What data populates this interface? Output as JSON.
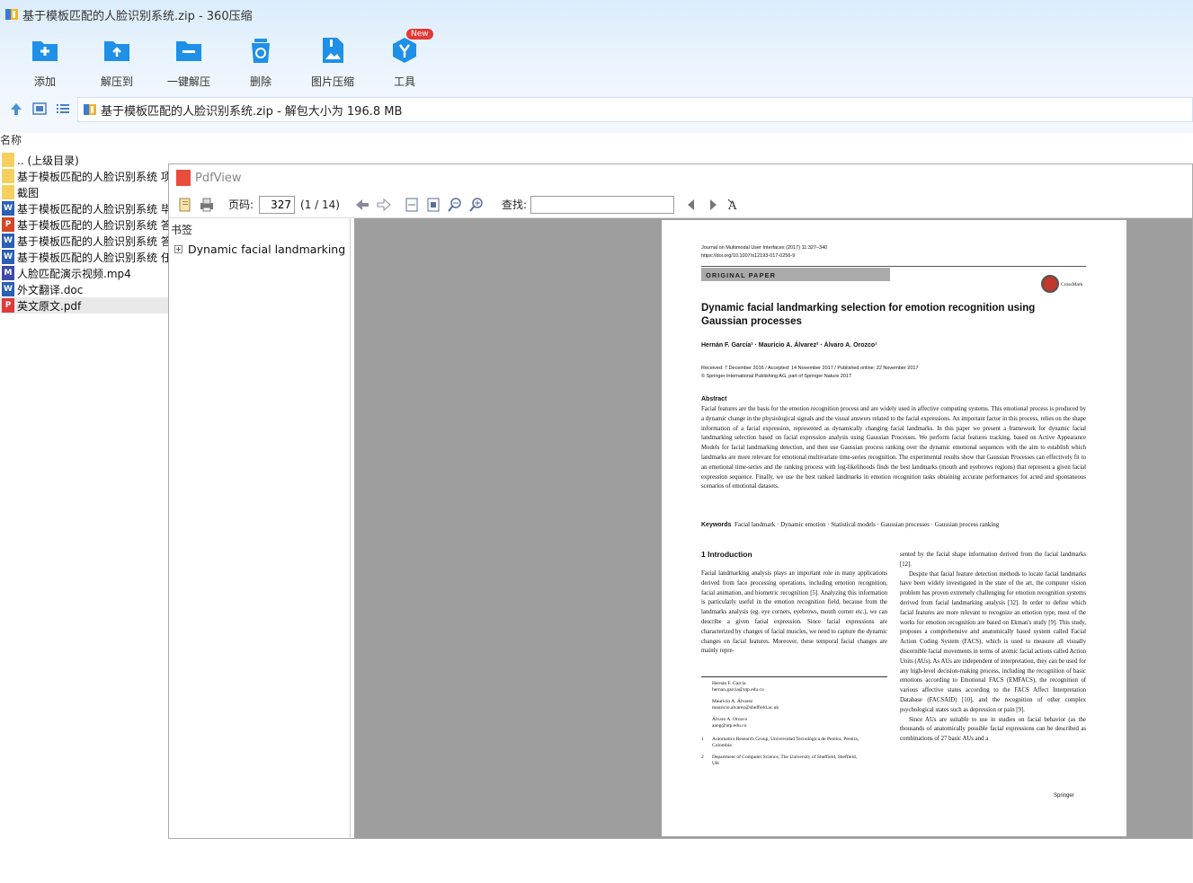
{
  "window": {
    "title": "基于模板匹配的人脸识别系统.zip - 360压缩"
  },
  "toolbar": {
    "buttons": [
      {
        "label": "添加",
        "icon": "add-icon"
      },
      {
        "label": "解压到",
        "icon": "extract-to-icon"
      },
      {
        "label": "一键解压",
        "icon": "one-click-extract-icon"
      },
      {
        "label": "删除",
        "icon": "delete-icon"
      },
      {
        "label": "图片压缩",
        "icon": "image-compress-icon"
      },
      {
        "label": "工具",
        "icon": "tools-icon"
      }
    ],
    "new_badge": "New"
  },
  "address": {
    "text": "基于模板匹配的人脸识别系统.zip - 解包大小为 196.8 MB"
  },
  "filelist": {
    "column_name": "名称",
    "items": [
      {
        "name": ".. (上级目录)",
        "type": "folder"
      },
      {
        "name": "基于模板匹配的人脸识别系统 项",
        "type": "folder"
      },
      {
        "name": "截图",
        "type": "folder"
      },
      {
        "name": "基于模板匹配的人脸识别系统 毕",
        "type": "word"
      },
      {
        "name": "基于模板匹配的人脸识别系统 答",
        "type": "ppt"
      },
      {
        "name": "基于模板匹配的人脸识别系统 答",
        "type": "word"
      },
      {
        "name": "基于模板匹配的人脸识别系统 任",
        "type": "word"
      },
      {
        "name": "人脸匹配演示视频.mp4",
        "type": "mp4"
      },
      {
        "name": "外文翻译.doc",
        "type": "word"
      },
      {
        "name": "英文原文.pdf",
        "type": "pdf"
      }
    ],
    "selected_index": 9
  },
  "pdfview": {
    "title": "PdfView",
    "page_label": "页码:",
    "page_value": "327",
    "page_count": "(1 / 14)",
    "search_label": "查找:",
    "bookmarks_label": "书签",
    "bookmark_item": "Dynamic facial landmarking se"
  },
  "paper": {
    "journal": "Journal on Multimodal User Interfaces (2017) 11:327–340",
    "doi": "https://doi.org/10.1007/s12193-017-0256-9",
    "section_tag": "ORIGINAL PAPER",
    "crossmark": "CrossMark",
    "title": "Dynamic facial landmarking selection for emotion recognition using Gaussian processes",
    "authors": "Hernán F. García¹ · Mauricio A. Álvarez² · Álvaro A. Orozco¹",
    "received": "Received: 7 December 2016 / Accepted: 14 November 2017 / Published online: 22 November 2017",
    "copyright": "© Springer International Publishing AG, part of Springer Nature 2017",
    "abstract_head": "Abstract",
    "abstract": "Facial features are the basis for the emotion recognition process and are widely used in affective computing systems. This emotional process is produced by a dynamic change in the physiological signals and the visual answers related to the facial expressions. An important factor in this process, relies on the shape information of a facial expression, represented as dynamically changing facial landmarks. In this paper we present a framework for dynamic facial landmarking selection based on facial expression analysis using Gaussian Processes. We perform facial features tracking, based on Active Appearance Models for facial landmarking detection, and then use Gaussian process ranking over the dynamic emotional sequences with the aim to establish which landmarks are more relevant for emotional multivariate time-series recognition. The experimental results show that Gaussian Processes can effectively fit to an emotional time-series and the ranking process with log-likelihoods finds the best landmarks (mouth and eyebrows regions) that represent a given facial expression sequence. Finally, we use the best ranked landmarks in emotion recognition tasks obtaining accurate performances for acted and spontaneous scenarios of emotional datasets.",
    "keywords_head": "Keywords",
    "keywords": "Facial landmark · Dynamic emotion · Statistical models · Gaussian processes · Gaussian process ranking",
    "intro_head": "1 Introduction",
    "intro_left": "Facial landmarking analysis plays an important role in many applications derived from face processing operations, including emotion recognition, facial animation, and biometric recognition [5]. Analyzing this information is particularly useful in the emotion recognition field, because from the landmarks analysis (eg. eye corners, eyebrows, mouth corner etc.), we can describe a given facial expression. Since facial expressions are characterized by changes of facial muscles, we need to capture the dynamic changes on facial features. Moreover, these temporal facial changes are mainly repre-",
    "intro_right_1": "sented by the facial shape information derived from the facial landmarks [12].",
    "intro_right_2": "Despite that facial feature detection methods to locate facial landmarks have been widely investigated in the state of the art, the computer vision problem has proven extremely challenging for emotion recognition systems derived from facial landmarking analysis [32]. In order to define which facial features are more relevant to recognize an emotion type, most of the works for emotion recognition are based on Ekman's study [9]. This study, proposes a comprehensive and anatomically based system called Facial Action Coding System (FACS), which is used to measure all visually discernible facial movements in terms of atomic facial actions called Action Units (AUs). As AUs are independent of interpretation, they can be used for any high-level decision-making process, including the recognition of basic emotions according to Emotional FACS (EMFACS), the recognition of various affective states according to the FACS Affect Interpretation Database (FACSAID) [10], and the recognition of other complex psychological states such as depression or pain [9].",
    "intro_right_3": "Since AUs are suitable to use in studies on facial behavior (as the thousands of anatomically possible facial expressions can be described as combinations of 27 basic AUs and a",
    "fn_author1": "Hernán F. García",
    "fn_email1": "hernan.garcia@utp.edu.co",
    "fn_author2": "Mauricio A. Álvarez",
    "fn_email2": "mauricio.alvarez@sheffield.ac.uk",
    "fn_author3": "Álvaro A. Orozco",
    "fn_email3": "aaog@utp.edu.co",
    "fn_num1": "1",
    "fn_aff1": "Automatics Research Group, Universidad Tecnológica de Pereira, Pereira, Colombia",
    "fn_num2": "2",
    "fn_aff2": "Department of Computer Science, The University of Sheffield, Sheffield, UK",
    "publisher": "Springer"
  },
  "colors": {
    "accent": "#1e90e8",
    "viewer_bg": "#9e9e9e"
  }
}
